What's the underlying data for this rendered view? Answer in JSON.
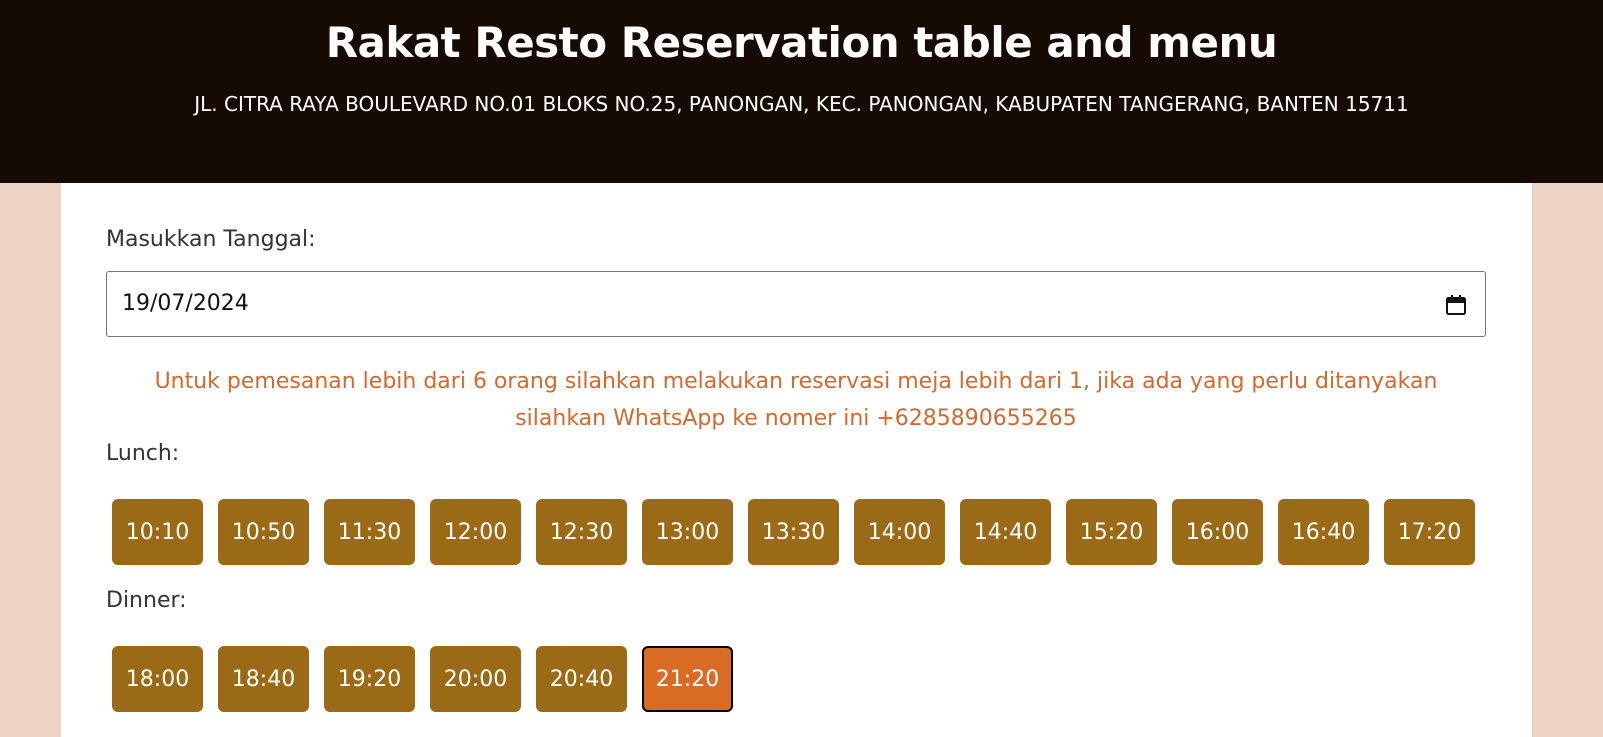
{
  "header": {
    "title": "Rakat Resto Reservation table and menu",
    "address": "JL. CITRA RAYA BOULEVARD NO.01 BLOKS NO.25, PANONGAN, KEC. PANONGAN, KABUPATEN TANGERANG, BANTEN 15711"
  },
  "form": {
    "date_label": "Masukkan Tanggal:",
    "date_value": "19/07/2024",
    "notice": "Untuk pemesanan lebih dari 6 orang silahkan melakukan reservasi meja lebih dari 1, jika ada yang perlu ditanyakan silahkan WhatsApp ke nomer ini +6285890655265",
    "lunch_label": "Lunch:",
    "dinner_label": "Dinner:",
    "lunch_slots": [
      "10:10",
      "10:50",
      "11:30",
      "12:00",
      "12:30",
      "13:00",
      "13:30",
      "14:00",
      "14:40",
      "15:20",
      "16:00",
      "16:40",
      "17:20"
    ],
    "dinner_slots": [
      "18:00",
      "18:40",
      "19:20",
      "20:00",
      "20:40",
      "21:20"
    ],
    "selected_slot": "21:20"
  },
  "colors": {
    "header_bg": "#150b03",
    "page_bg": "#ecd3c3",
    "slot_bg": "#9a6a16",
    "slot_selected_bg": "#d96b24",
    "notice_text": "#d2692e"
  },
  "icons": {
    "date_picker": "calendar-icon"
  }
}
